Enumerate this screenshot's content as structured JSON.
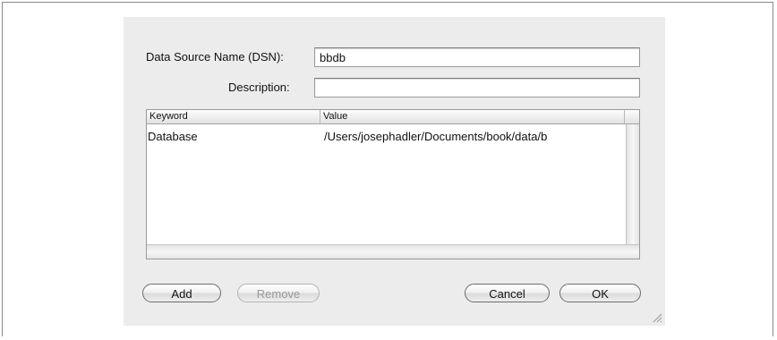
{
  "form": {
    "dsn_label": "Data Source Name (DSN):",
    "dsn_value": "bbdb",
    "description_label": "Description:",
    "description_value": ""
  },
  "table": {
    "columns": [
      "Keyword",
      "Value"
    ],
    "rows": [
      {
        "keyword": "Database",
        "value": "/Users/josephadler/Documents/book/data/b"
      }
    ]
  },
  "buttons": {
    "add": "Add",
    "remove": "Remove",
    "cancel": "Cancel",
    "ok": "OK"
  },
  "icons": {
    "resize": "resize-grip-icon"
  }
}
